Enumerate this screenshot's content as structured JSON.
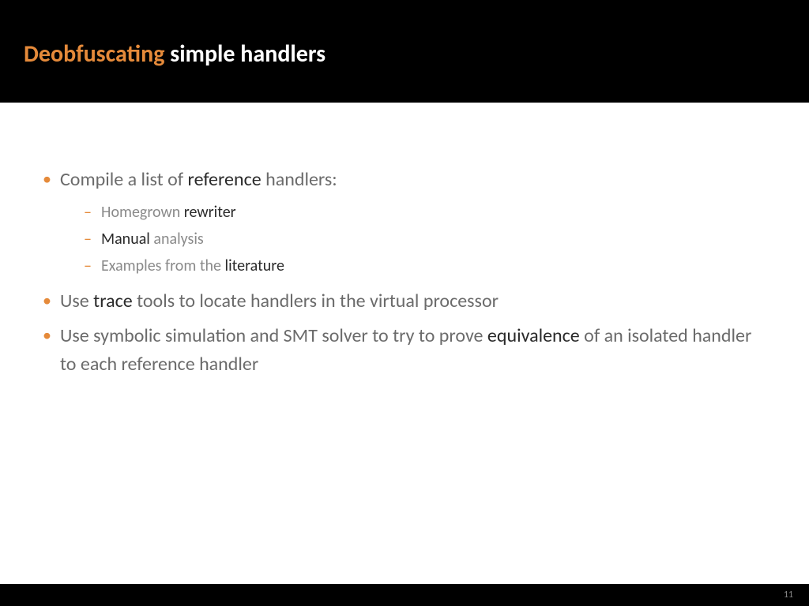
{
  "header": {
    "title_accent": "Deobfuscating",
    "title_rest": " simple handlers"
  },
  "bullets": {
    "b1_pre": "Compile a list of ",
    "b1_dark": "reference",
    "b1_post": " handlers:",
    "s1_pre": "Homegrown ",
    "s1_dark": "rewriter",
    "s2_dark": "Manual",
    "s2_post": " analysis",
    "s3_pre": "Examples from the ",
    "s3_dark": "literature",
    "b2_pre": "Use ",
    "b2_dark": "trace",
    "b2_post": " tools to locate handlers in the virtual processor",
    "b3_line1": "Use symbolic simulation and SMT solver to try to prove ",
    "b3_dark": "equivalence",
    "b3_post": " of an isolated handler to each reference handler"
  },
  "footer": {
    "page": "11"
  }
}
